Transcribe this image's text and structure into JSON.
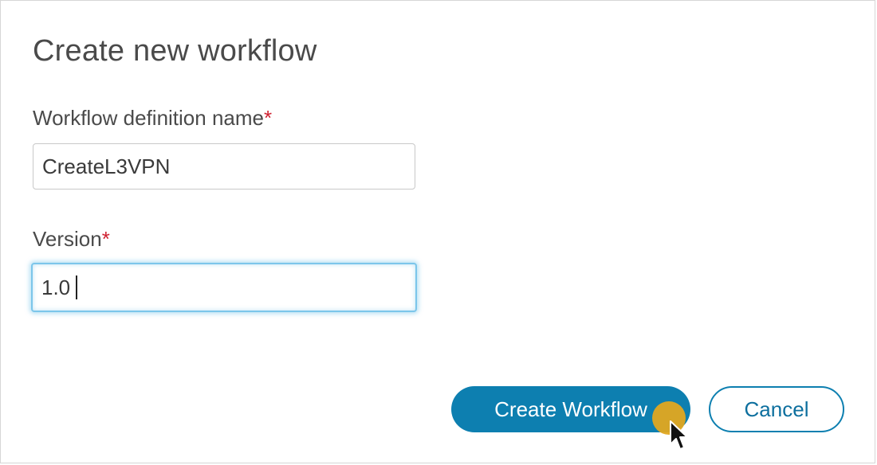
{
  "dialog": {
    "title": "Create new workflow"
  },
  "form": {
    "name_field": {
      "label": "Workflow definition name",
      "required_mark": "*",
      "value": "CreateL3VPN"
    },
    "version_field": {
      "label": "Version",
      "required_mark": "*",
      "value": "1.0"
    }
  },
  "actions": {
    "create_label": "Create Workflow",
    "cancel_label": "Cancel"
  },
  "colors": {
    "primary": "#0d7fb0",
    "required": "#cf2030",
    "focus_ring": "#7cc6ea",
    "cursor_highlight": "#e1a820"
  },
  "icons": {
    "pointer": "mouse-pointer-icon"
  }
}
